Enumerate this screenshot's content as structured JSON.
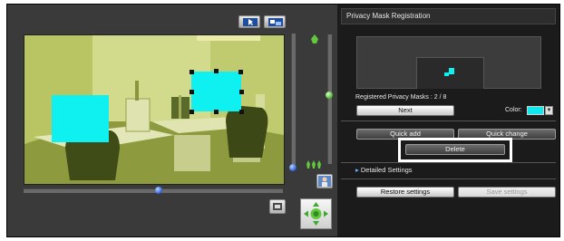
{
  "camera": {
    "toolbar": {
      "select_tool": "pointer-icon",
      "fit_tool": "fit-window-icon"
    },
    "masks_on_image": 2,
    "mask_color": "#0ff0f0",
    "zoom_slider": {
      "top_icon": "zoom-in-icon",
      "bottom_icon": "zoom-out-icon",
      "level": 0.45
    },
    "focus_slider": {
      "level": 0.05
    },
    "pan_slider": {
      "level": 0.52
    },
    "buttons": {
      "snapshot": "snapshot-icon",
      "aux": "preset-icon",
      "ptz": "pan-tilt-icon"
    }
  },
  "panel": {
    "title": "Privacy Mask Registration",
    "registered_label": "Registered Privacy Masks : 2 / 8",
    "next_label": "Next",
    "color_label": "Color:",
    "color_value": "#11e8ee",
    "quick_add_label": "Quick add",
    "quick_change_label": "Quick change",
    "delete_label": "Delete",
    "detailed_settings_label": "Detailed Settings",
    "restore_label": "Restore settings",
    "save_label": "Save settings"
  }
}
